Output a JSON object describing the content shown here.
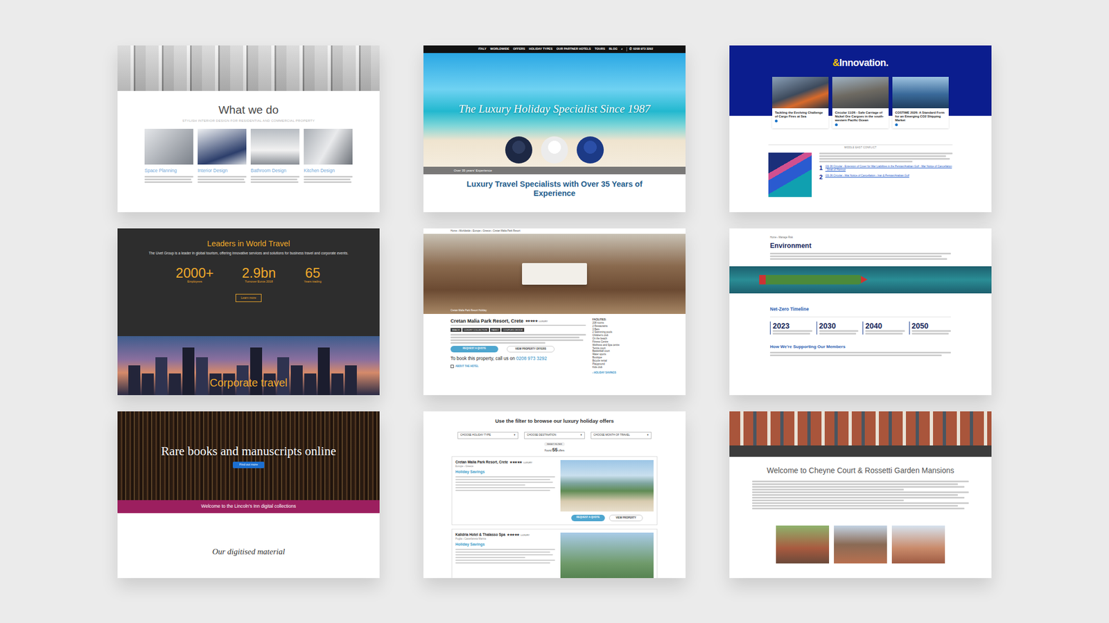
{
  "cards": [
    {
      "kind": "interior",
      "heading": "What we do",
      "subheading": "STYLISH INTERIOR DESIGN FOR RESIDENTIAL AND COMMERCIAL PROPERTY",
      "services": [
        "Space Planning",
        "Interior Design",
        "Bathroom Design",
        "Kitchen Design"
      ]
    },
    {
      "kind": "travel",
      "nav": [
        "ITALY",
        "WORLDWIDE",
        "OFFERS",
        "HOLIDAY TYPES",
        "OUR PARTNER HOTELS",
        "TOURS",
        "BLOG"
      ],
      "search_icon": "⌕",
      "phone_icon": "✆",
      "phone": "0208 973 3292",
      "hero_title": "The Luxury Holiday Specialist Since 1987",
      "hero_strip": "Over 35 years' Experience",
      "heading": "Luxury Travel Specialists with Over 35 Years of Experience"
    },
    {
      "kind": "insurance",
      "brand_mark": "&",
      "brand_word": "Innovation.",
      "news": [
        "Tackling the Evolving Challenge of Cargo Fires at Sea",
        "Circular 11/26 - Safe Carriage of Nickel Ore Cargoes in the south-western Pacific Ocean",
        "COSTIME 2026: A Standard Form for an Emerging CO2 Shipping Market"
      ],
      "section": "MIDDLE EAST CONFLICT",
      "links": [
        {
          "num": "1",
          "text": "GS 06 Circular - Extension of Cover for War Liabilities in the Persian/Arabian Gulf - War Notice of Cancellation - Strait of Hormuz"
        },
        {
          "num": "2",
          "text": "GS 06 Circular - War Notice of Cancellation - Iran & Persian/Arabian Gulf"
        }
      ]
    },
    {
      "kind": "corporate",
      "title": "Leaders in World Travel",
      "intro": "The Uvet Group is a leader in global tourism, offering innovative services and solutions for business travel and corporate events.",
      "stats": [
        {
          "value": "2000+",
          "label": "Employees"
        },
        {
          "value": "2.9bn",
          "label": "Turnover Euros 2018"
        },
        {
          "value": "65",
          "label": "Years trading"
        }
      ],
      "button": "Learn more",
      "banner": "Corporate travel"
    },
    {
      "kind": "hotel",
      "breadcrumb": "Home › Worldwide › Europe › Greece › Cretan Malia Park Resort",
      "photo_caption": "Cretan Malia Park Resort Holiday",
      "name": "Cretan Malia Park Resort, Crete",
      "star": "★",
      "stars": 5,
      "grade": "LUXURY",
      "tags": [
        "BEACH",
        "LUXURY COLLECTION",
        "FAMILY",
        "COUPLES CHOICE"
      ],
      "buttons": [
        "REQUEST A QUOTE",
        "VIEW PROPERTY OFFERS"
      ],
      "call": "To book this property, call us on",
      "phone": "0208 973 3292",
      "about": "ABOUT THE HOTEL",
      "facilities_title": "FACILITIES:",
      "facilities": [
        "208 rooms",
        "2 Restaurants",
        "3 Bars",
        "2 Swimming pools",
        "Children's club",
        "On the beach",
        "Fitness Centre",
        "Wellness and Spa centre",
        "Tennis court",
        "Basketball court",
        "Water sports",
        "Boutique",
        "Bicycle rental",
        "Playground",
        "Kids club"
      ],
      "savings": "› HOLIDAY SAVINGS"
    },
    {
      "kind": "environment",
      "breadcrumb": "Home › Manage Risk",
      "title": "Environment",
      "timeline_title": "Net-Zero Timeline",
      "years": [
        "2023",
        "2030",
        "2040",
        "2050"
      ],
      "support_title": "How We're Supporting Our Members"
    },
    {
      "kind": "library",
      "hero": "Rare books and manuscripts online",
      "button": "Find out more",
      "strip": "Welcome to the Lincoln's Inn digital collections",
      "section": "Our digitised material"
    },
    {
      "kind": "offers",
      "heading": "Use the filter to browse our luxury holiday offers",
      "caret": "▾",
      "filters": [
        "CHOOSE HOLIDAY TYPE",
        "CHOOSE DESTINATION",
        "CHOOSE MONTH OF TRAVEL"
      ],
      "reset": "RESET FILTER",
      "found_label": "Found",
      "found_count": "55",
      "found_unit": "offers",
      "star": "★",
      "offers": [
        {
          "name": "Cretan Malia Park Resort, Crete",
          "stars": 5,
          "grade": "LUXURY",
          "location": "Europe › Greece",
          "savings": "Holiday Savings",
          "buttons": [
            "REQUEST A QUOTE",
            "VIEW PROPERTY"
          ]
        },
        {
          "name": "Kalidria Hotel & Thalasso Spa",
          "stars": 5,
          "grade": "LUXURY",
          "location": "Puglia › Castellaneta Marina",
          "savings": "Holiday Savings",
          "buttons": []
        }
      ]
    },
    {
      "kind": "mansions",
      "title": "Welcome to Cheyne Court & Rossetti Garden Mansions"
    }
  ]
}
